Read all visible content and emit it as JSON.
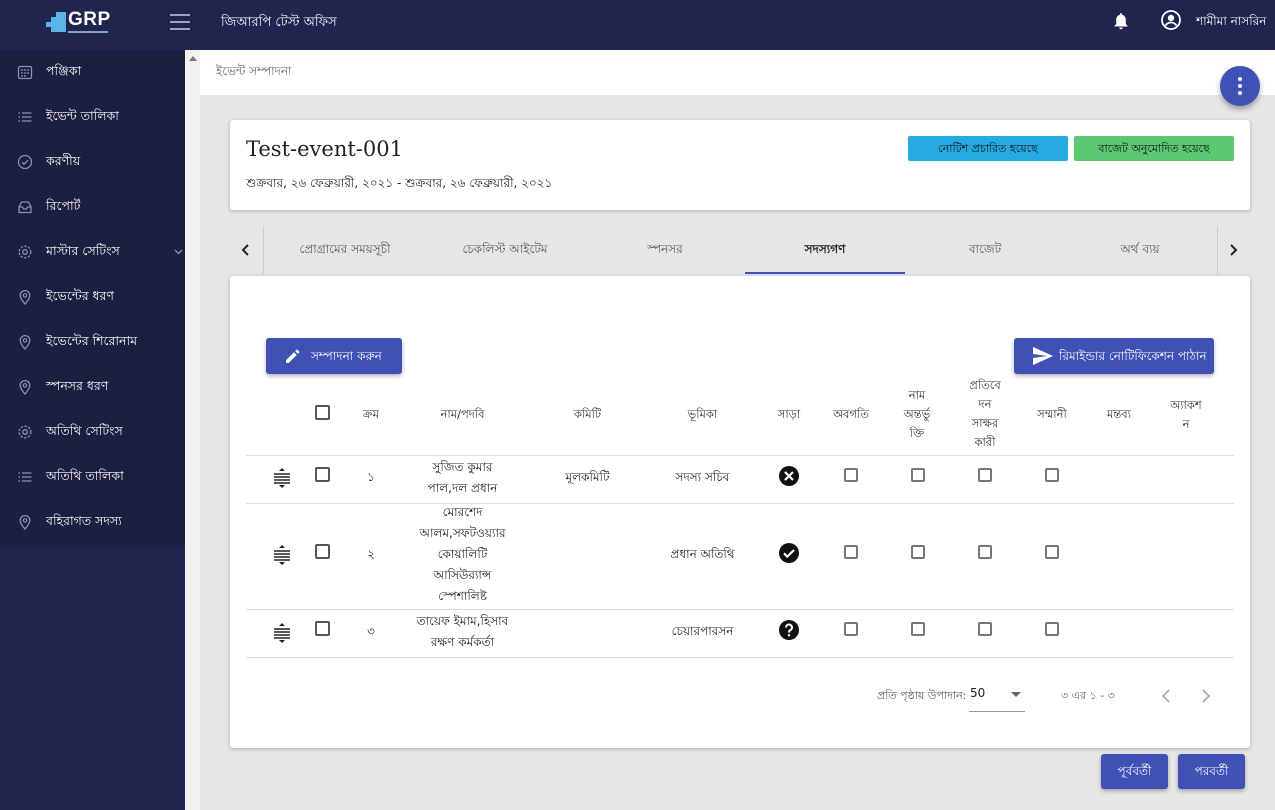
{
  "header": {
    "logo_text": "GRP",
    "office_title": "জিআরপি টেস্ট অফিস",
    "user_name": "শামীমা নাসরিন"
  },
  "sidebar": {
    "items": [
      {
        "label": "পঞ্জিকা",
        "icon": "calendar-icon"
      },
      {
        "label": "ইভেন্ট তালিকা",
        "icon": "list-icon"
      },
      {
        "label": "করণীয়",
        "icon": "check-circle-icon"
      },
      {
        "label": "রিপোর্ট",
        "icon": "inbox-icon"
      },
      {
        "label": "মাস্টার সেটিংস",
        "icon": "gear-icon"
      },
      {
        "label": "ইভেন্টের ধরণ",
        "icon": "location-pin-icon"
      },
      {
        "label": "ইভেন্টের শিরোনাম",
        "icon": "location-pin-icon"
      },
      {
        "label": "স্পনসর ধরণ",
        "icon": "location-pin-icon"
      },
      {
        "label": "অতিথি সেটিংস",
        "icon": "gear-icon"
      },
      {
        "label": "অতিথি তালিকা",
        "icon": "list-icon"
      },
      {
        "label": "বহিরাগত সদস্য",
        "icon": "location-pin-icon"
      }
    ]
  },
  "breadcrumb": "ইভেন্ট সম্পাদনা",
  "event": {
    "title": "Test-event-001",
    "date": "শুক্রবার, ২৬ ফেব্রুয়ারী, ২০২১ - শুক্রবার, ২৬ ফেব্রুয়ারী, ২০২১",
    "badge_notice": "নোটিশ প্রচারিত হয়েছে",
    "badge_budget": "বাজেট অনুমোদিত হয়েছে",
    "badge_notice_color": "#27aae1",
    "badge_budget_color": "#5cc873"
  },
  "tabs": [
    {
      "label": "প্রোগ্রামের সময়সূচী"
    },
    {
      "label": "চেকলিস্ট আইটেম"
    },
    {
      "label": "স্পনসর"
    },
    {
      "label": "সদস্যগণ",
      "active": true
    },
    {
      "label": "বাজেট"
    },
    {
      "label": "অর্থ ব্যয়"
    }
  ],
  "actions": {
    "edit_label": "সম্পাদনা করুন",
    "reminder_label": "রিমাইন্ডার নোটিফিকেশন পাঠান"
  },
  "table": {
    "headers": {
      "serial": "ক্রম",
      "name": "নাম/পদবি",
      "committee": "কমিটি",
      "role": "ভূমিকা",
      "response": "সাড়া",
      "informed": "অবগতি",
      "name_incl_1": "নাম",
      "name_incl_2": "অন্তর্ভু",
      "name_incl_3": "ক্তি",
      "signer_1": "প্রতিবে",
      "signer_2": "দন",
      "signer_3": "সাক্ষর",
      "signer_4": "কারী",
      "honorarium": "সম্মানী",
      "comment": "মন্তব্য",
      "action_1": "অ্যাকশ",
      "action_2": "ন"
    },
    "rows": [
      {
        "serial": "১",
        "name_lines": [
          "সুজিত কুমার",
          "পাল,দল প্রধান"
        ],
        "committee": "মূলকমিটি",
        "role": "সদস্য সচিব",
        "response": "declined"
      },
      {
        "serial": "২",
        "name_lines": [
          "মোরশেদ",
          "আলম,সফটওয়্যার",
          "কোয়ালিটি",
          "আসিউর‍্যান্স",
          "স্পেশালিষ্ট"
        ],
        "committee": "",
        "role": "প্রধান অতিথি",
        "response": "accepted"
      },
      {
        "serial": "৩",
        "name_lines": [
          "তায়েফ ইমাম,হিসাব",
          "রক্ষণ কর্মকর্তা"
        ],
        "committee": "",
        "role": "চেয়ারপারসন",
        "response": "unknown"
      }
    ]
  },
  "paginator": {
    "label": "প্রতি পৃষ্ঠায় উপাদান:",
    "page_size": "50",
    "range": "৩ এর ১ - ৩"
  },
  "footer_nav": {
    "prev_label": "পূর্ববর্তী",
    "next_label": "পরবর্তী"
  }
}
